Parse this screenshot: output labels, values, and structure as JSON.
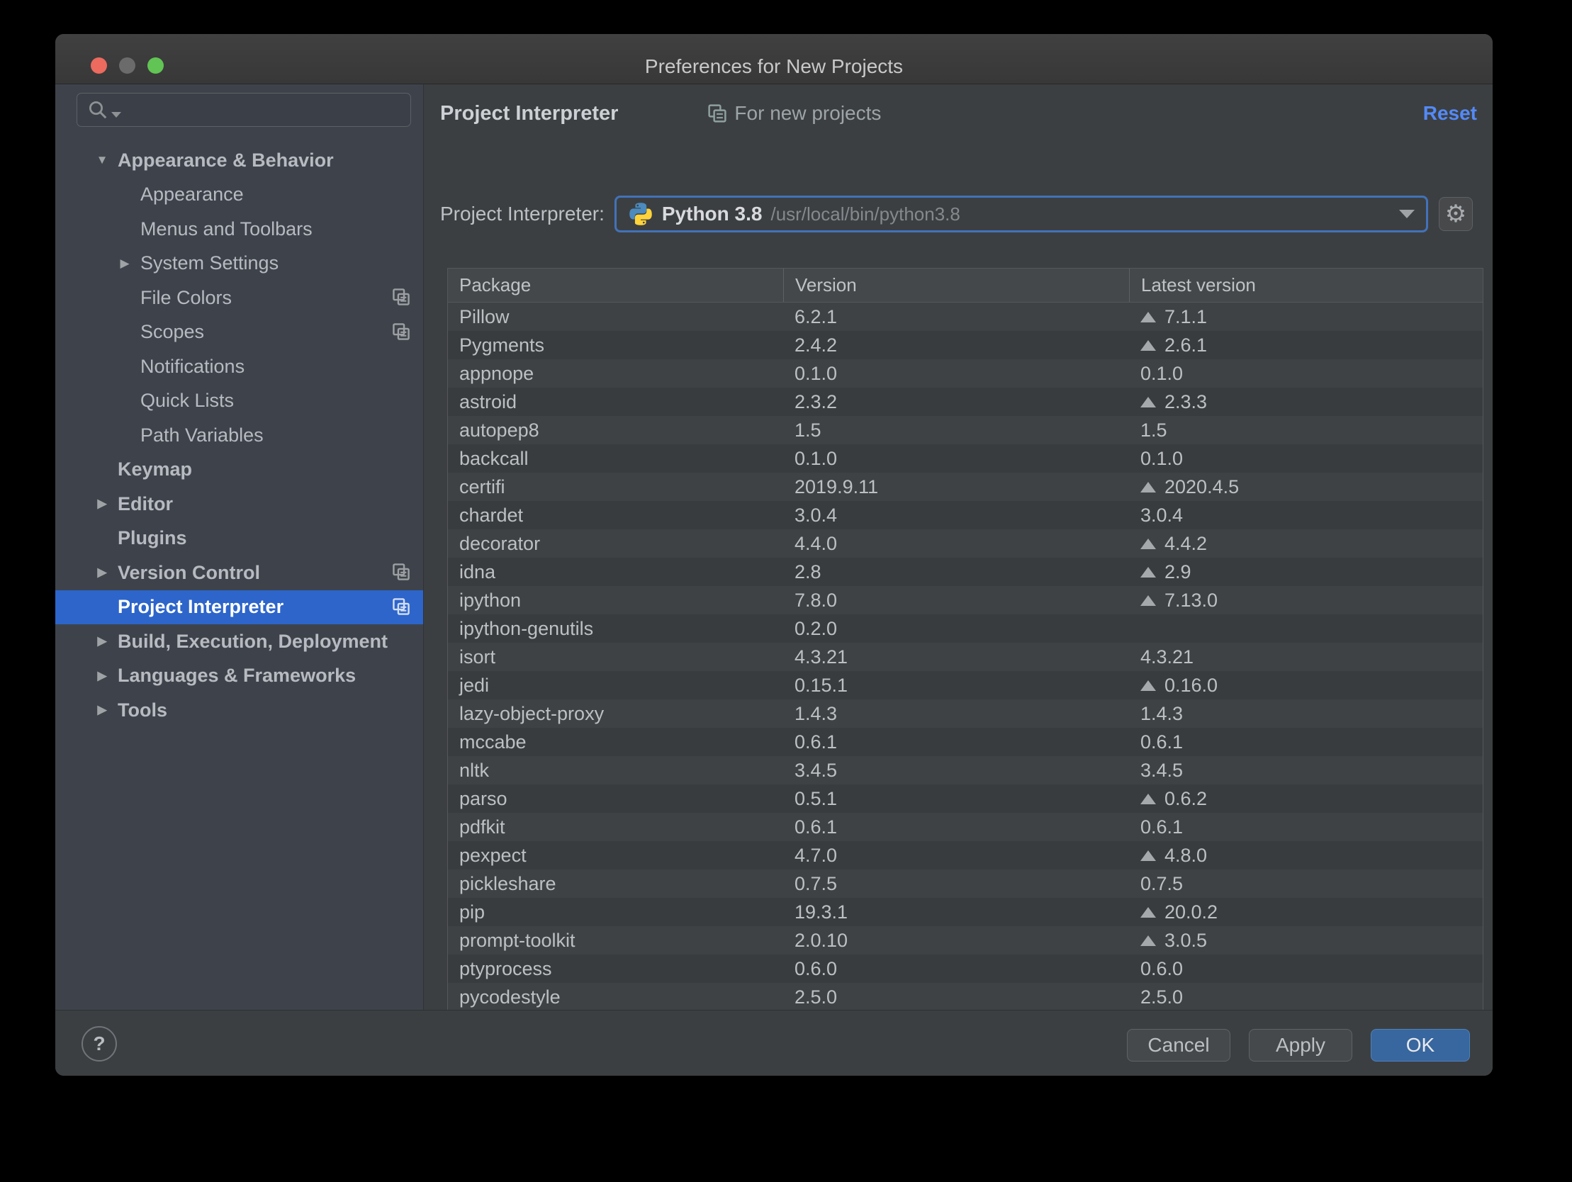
{
  "window": {
    "title": "Preferences for New Projects"
  },
  "titlebar_buttons": [
    "close",
    "minimize",
    "zoom"
  ],
  "colors": {
    "selection_blue": "#2D65CA",
    "link_blue": "#548AF7",
    "ok_button_blue": "#38669E",
    "focus_ring_blue": "#4272B9",
    "traffic_red": "#EC6A5E",
    "traffic_gray": "#6B6B6B",
    "traffic_green": "#61C454"
  },
  "icons": {
    "search": "magnifier",
    "search_caret": "triangle-down",
    "scope": "copy-pages",
    "shared": "copy-pages",
    "combo_caret": "triangle-down",
    "gear": "⚙",
    "add": "+",
    "remove": "−",
    "upgrade": "triangle-up",
    "eye": "eye",
    "help": "?"
  },
  "sidebar": {
    "search_placeholder": "",
    "items": [
      {
        "label": "Appearance & Behavior",
        "bold": true,
        "arrow": "expanded",
        "indent": 0,
        "shared": false,
        "selected": false
      },
      {
        "label": "Appearance",
        "bold": false,
        "arrow": "none",
        "indent": 1,
        "shared": false,
        "selected": false
      },
      {
        "label": "Menus and Toolbars",
        "bold": false,
        "arrow": "none",
        "indent": 1,
        "shared": false,
        "selected": false
      },
      {
        "label": "System Settings",
        "bold": false,
        "arrow": "collapsed",
        "indent": 1,
        "shared": false,
        "selected": false
      },
      {
        "label": "File Colors",
        "bold": false,
        "arrow": "none",
        "indent": 1,
        "shared": true,
        "selected": false
      },
      {
        "label": "Scopes",
        "bold": false,
        "arrow": "none",
        "indent": 1,
        "shared": true,
        "selected": false
      },
      {
        "label": "Notifications",
        "bold": false,
        "arrow": "none",
        "indent": 1,
        "shared": false,
        "selected": false
      },
      {
        "label": "Quick Lists",
        "bold": false,
        "arrow": "none",
        "indent": 1,
        "shared": false,
        "selected": false
      },
      {
        "label": "Path Variables",
        "bold": false,
        "arrow": "none",
        "indent": 1,
        "shared": false,
        "selected": false
      },
      {
        "label": "Keymap",
        "bold": true,
        "arrow": "none",
        "indent": 0,
        "shared": false,
        "selected": false
      },
      {
        "label": "Editor",
        "bold": true,
        "arrow": "collapsed",
        "indent": 0,
        "shared": false,
        "selected": false
      },
      {
        "label": "Plugins",
        "bold": true,
        "arrow": "none",
        "indent": 0,
        "shared": false,
        "selected": false
      },
      {
        "label": "Version Control",
        "bold": true,
        "arrow": "collapsed",
        "indent": 0,
        "shared": true,
        "selected": false
      },
      {
        "label": "Project Interpreter",
        "bold": true,
        "arrow": "none",
        "indent": 0,
        "shared": true,
        "selected": true
      },
      {
        "label": "Build, Execution, Deployment",
        "bold": true,
        "arrow": "collapsed",
        "indent": 0,
        "shared": false,
        "selected": false
      },
      {
        "label": "Languages & Frameworks",
        "bold": true,
        "arrow": "collapsed",
        "indent": 0,
        "shared": false,
        "selected": false
      },
      {
        "label": "Tools",
        "bold": true,
        "arrow": "collapsed",
        "indent": 0,
        "shared": false,
        "selected": false
      }
    ]
  },
  "header": {
    "title": "Project Interpreter",
    "scope_label": "For new projects",
    "reset_label": "Reset"
  },
  "interpreter": {
    "label": "Project Interpreter:",
    "name": "Python 3.8",
    "path": "/usr/local/bin/python3.8"
  },
  "packages": {
    "columns": [
      "Package",
      "Version",
      "Latest version"
    ],
    "rows": [
      {
        "name": "Pillow",
        "version": "6.2.1",
        "latest": "7.1.1",
        "upgrade": true
      },
      {
        "name": "Pygments",
        "version": "2.4.2",
        "latest": "2.6.1",
        "upgrade": true
      },
      {
        "name": "appnope",
        "version": "0.1.0",
        "latest": "0.1.0",
        "upgrade": false
      },
      {
        "name": "astroid",
        "version": "2.3.2",
        "latest": "2.3.3",
        "upgrade": true
      },
      {
        "name": "autopep8",
        "version": "1.5",
        "latest": "1.5",
        "upgrade": false
      },
      {
        "name": "backcall",
        "version": "0.1.0",
        "latest": "0.1.0",
        "upgrade": false
      },
      {
        "name": "certifi",
        "version": "2019.9.11",
        "latest": "2020.4.5",
        "upgrade": true
      },
      {
        "name": "chardet",
        "version": "3.0.4",
        "latest": "3.0.4",
        "upgrade": false
      },
      {
        "name": "decorator",
        "version": "4.4.0",
        "latest": "4.4.2",
        "upgrade": true
      },
      {
        "name": "idna",
        "version": "2.8",
        "latest": "2.9",
        "upgrade": true
      },
      {
        "name": "ipython",
        "version": "7.8.0",
        "latest": "7.13.0",
        "upgrade": true
      },
      {
        "name": "ipython-genutils",
        "version": "0.2.0",
        "latest": "",
        "upgrade": false
      },
      {
        "name": "isort",
        "version": "4.3.21",
        "latest": "4.3.21",
        "upgrade": false
      },
      {
        "name": "jedi",
        "version": "0.15.1",
        "latest": "0.16.0",
        "upgrade": true
      },
      {
        "name": "lazy-object-proxy",
        "version": "1.4.3",
        "latest": "1.4.3",
        "upgrade": false
      },
      {
        "name": "mccabe",
        "version": "0.6.1",
        "latest": "0.6.1",
        "upgrade": false
      },
      {
        "name": "nltk",
        "version": "3.4.5",
        "latest": "3.4.5",
        "upgrade": false
      },
      {
        "name": "parso",
        "version": "0.5.1",
        "latest": "0.6.2",
        "upgrade": true
      },
      {
        "name": "pdfkit",
        "version": "0.6.1",
        "latest": "0.6.1",
        "upgrade": false
      },
      {
        "name": "pexpect",
        "version": "4.7.0",
        "latest": "4.8.0",
        "upgrade": true
      },
      {
        "name": "pickleshare",
        "version": "0.7.5",
        "latest": "0.7.5",
        "upgrade": false
      },
      {
        "name": "pip",
        "version": "19.3.1",
        "latest": "20.0.2",
        "upgrade": true
      },
      {
        "name": "prompt-toolkit",
        "version": "2.0.10",
        "latest": "3.0.5",
        "upgrade": true
      },
      {
        "name": "ptyprocess",
        "version": "0.6.0",
        "latest": "0.6.0",
        "upgrade": false
      },
      {
        "name": "pycodestyle",
        "version": "2.5.0",
        "latest": "2.5.0",
        "upgrade": false
      }
    ]
  },
  "toolbar": {
    "add": "+",
    "remove": "−"
  },
  "footer": {
    "help": "?",
    "cancel": "Cancel",
    "apply": "Apply",
    "ok": "OK"
  }
}
